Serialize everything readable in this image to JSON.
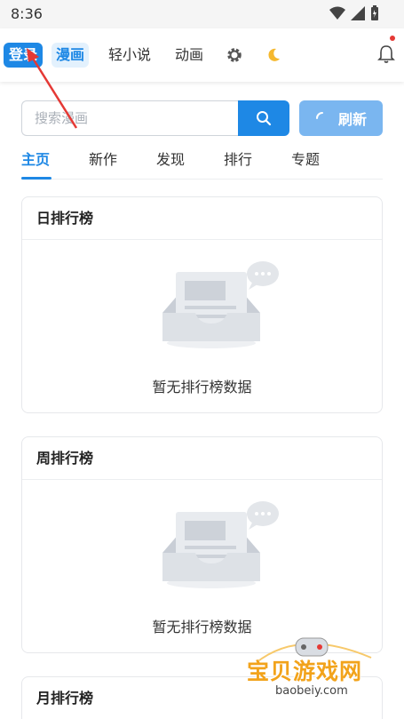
{
  "status_bar": {
    "time": "8:36"
  },
  "nav": {
    "login": "登录",
    "manga": "漫画",
    "light_novel": "轻小说",
    "anime": "动画"
  },
  "search": {
    "placeholder": "搜索漫画",
    "refresh": "刷新"
  },
  "tabs": [
    "主页",
    "新作",
    "发现",
    "排行",
    "专题"
  ],
  "cards": [
    {
      "title": "日排行榜",
      "empty": "暂无排行榜数据"
    },
    {
      "title": "周排行榜",
      "empty": "暂无排行榜数据"
    },
    {
      "title": "月排行榜"
    }
  ],
  "watermark": {
    "name": "宝贝游戏网",
    "domain": "baobeiy.com"
  },
  "colors": {
    "accent": "#1e88e5",
    "refresh": "#7ab6f0",
    "annotation": "#e53935",
    "watermark": "#f2a31b"
  }
}
